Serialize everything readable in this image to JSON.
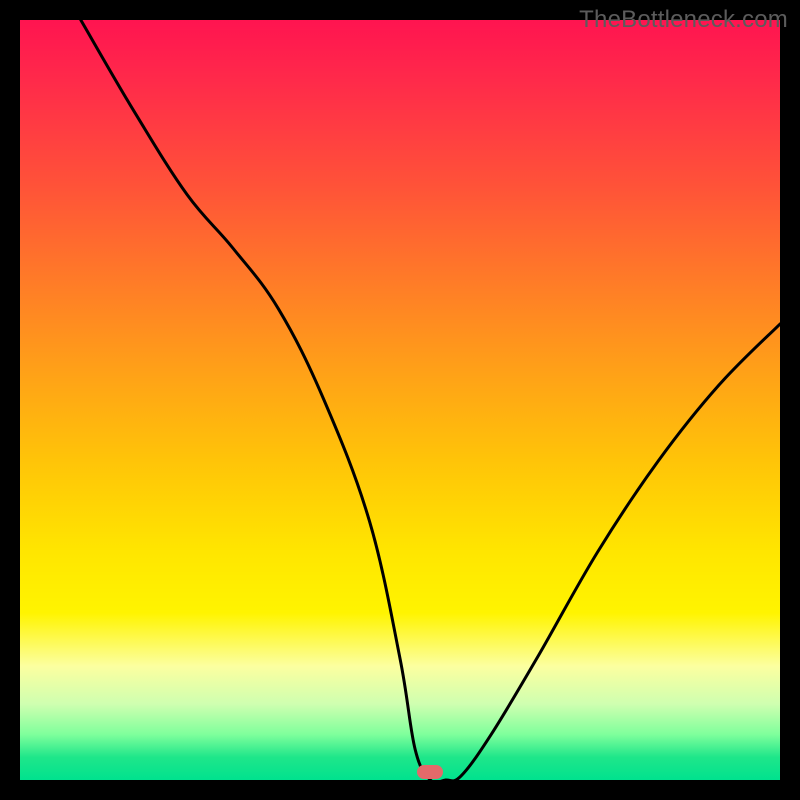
{
  "watermark": "TheBottleneck.com",
  "marker": {
    "x_pct": 54,
    "y_pct": 99
  },
  "chart_data": {
    "type": "line",
    "title": "",
    "xlabel": "",
    "ylabel": "",
    "xlim": [
      0,
      100
    ],
    "ylim": [
      0,
      100
    ],
    "grid": false,
    "series": [
      {
        "name": "bottleneck-curve",
        "x": [
          8,
          15,
          22,
          28,
          34,
          40,
          46,
          50,
          52,
          54,
          56,
          58,
          62,
          68,
          76,
          84,
          92,
          100
        ],
        "y": [
          100,
          88,
          77,
          70,
          62,
          50,
          34,
          16,
          4,
          0,
          0,
          0.5,
          6,
          16,
          30,
          42,
          52,
          60
        ]
      }
    ],
    "annotations": [
      {
        "type": "marker",
        "shape": "pill",
        "x": 54,
        "y": 0.5,
        "color": "#e36a6a"
      }
    ],
    "background_gradient": {
      "orientation": "vertical",
      "stops": [
        {
          "pos": 0.0,
          "color": "#ff1450"
        },
        {
          "pos": 0.5,
          "color": "#ffc408"
        },
        {
          "pos": 0.8,
          "color": "#fff400"
        },
        {
          "pos": 1.0,
          "color": "#00e28e"
        }
      ]
    }
  }
}
